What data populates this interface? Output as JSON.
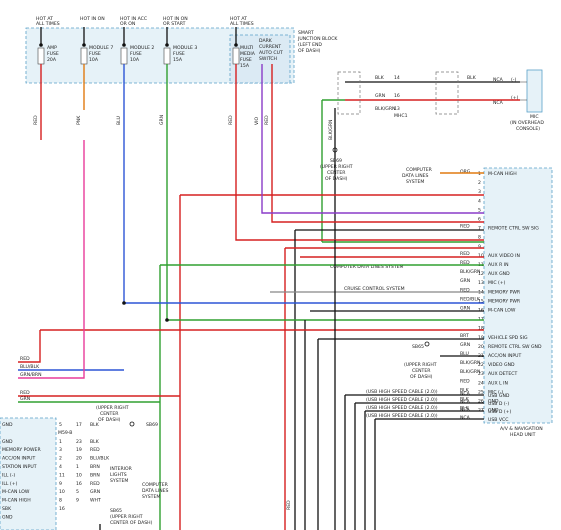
{
  "junction_block": {
    "title_lines": [
      "SMART",
      "JUNCTION BLOCK",
      "(LEFT END",
      "OF DASH)"
    ],
    "power_labels": [
      [
        "HOT AT",
        "ALL TIMES"
      ],
      [
        "HOT IN ON"
      ],
      [
        "HOT IN ACC",
        "OR ON"
      ],
      [
        "HOT IN ON",
        "OR START"
      ],
      [
        "HOT AT",
        "ALL TIMES"
      ]
    ],
    "fuses": [
      [
        "AMP",
        "FUSE",
        "20A"
      ],
      [
        "MODULE 7",
        "FUSE",
        "10A"
      ],
      [
        "MODULE 2",
        "FUSE",
        "10A"
      ],
      [
        "MODULE 3",
        "FUSE",
        "15A"
      ],
      [
        "MULTI",
        "MEDIA",
        "FUSE",
        "15A"
      ]
    ],
    "dark_current_lines": [
      "DARK",
      "CURRENT",
      "AUTO CUT",
      "SWITCH"
    ],
    "pin_labels": [
      "4E",
      "2I",
      "2B",
      "2F",
      "2T",
      "2A"
    ],
    "wire_labels": [
      "RED",
      "PNK",
      "BLU",
      "ORN",
      "GRN",
      "VIO"
    ],
    "pin_ids": [
      "27",
      "27",
      "21"
    ]
  },
  "mic": {
    "label_lines": [
      "MIC",
      "(IN OVERHEAD",
      "CONSOLE)"
    ],
    "terminals": [
      "NCA",
      "NCA",
      "(-)",
      "(+)"
    ],
    "wires": [
      {
        "color": "BLK",
        "pin": "14"
      },
      {
        "color": "BLK",
        "pin": "11"
      },
      {
        "color": "GRN",
        "pin": "16"
      },
      {
        "color": "BLK/GRN",
        "pin": "13"
      }
    ],
    "connector": "MHC1"
  },
  "sb69": {
    "label_lines": [
      "SB69",
      "(UPPER RIGHT",
      "CENTER",
      "OF DASH)"
    ],
    "wire": "BLK/GRN"
  },
  "head_unit": {
    "label_lines": [
      "A/V & NAVIGATION",
      "HEAD UNIT"
    ],
    "pins": [
      {
        "name": "M-CAN HIGH",
        "n": "1",
        "w": "ORG"
      },
      {
        "name": "",
        "n": "2",
        "w": ""
      },
      {
        "name": "",
        "n": "3",
        "w": ""
      },
      {
        "name": "",
        "n": "4",
        "w": ""
      },
      {
        "name": "",
        "n": "5",
        "w": ""
      },
      {
        "name": "",
        "n": "6",
        "w": ""
      },
      {
        "name": "REMOTE CTRL SW SIG",
        "n": "7",
        "w": "RED"
      },
      {
        "name": "",
        "n": "8",
        "w": ""
      },
      {
        "name": "",
        "n": "9",
        "w": ""
      },
      {
        "name": "AUX VIDEO IN",
        "n": "10",
        "w": "RED"
      },
      {
        "name": "AUX R IN",
        "n": "11",
        "w": "RED"
      },
      {
        "name": "AUX GND",
        "n": "12",
        "w": "BLK/GRN"
      },
      {
        "name": "MIC (+)",
        "n": "13",
        "w": "GRN"
      },
      {
        "name": "MEMORY PWR",
        "n": "14",
        "w": "RED"
      },
      {
        "name": "MEMORY PWR",
        "n": "15",
        "w": "RED/BLK"
      },
      {
        "name": "M-CAN LOW",
        "n": "16",
        "w": "GRN"
      },
      {
        "name": "",
        "n": "17",
        "w": ""
      },
      {
        "name": "",
        "n": "18",
        "w": ""
      },
      {
        "name": "VEHICLE SPD SIG",
        "n": "19",
        "w": "BRT"
      },
      {
        "name": "REMOTE CTRL SW GND",
        "n": "20",
        "w": "GRN"
      },
      {
        "name": "ACC/ON INPUT",
        "n": "21",
        "w": "BLU"
      },
      {
        "name": "VIDEO GND",
        "n": "22",
        "w": "BLK/GRN"
      },
      {
        "name": "AUX DETECT",
        "n": "23",
        "w": "BLK/GRN"
      },
      {
        "name": "AUX L IN",
        "n": "24",
        "w": "RED"
      },
      {
        "name": "MIC (-)",
        "n": "25",
        "w": "BLK"
      },
      {
        "name": "GND",
        "n": "26",
        "w": "BLK"
      },
      {
        "name": "GND",
        "n": "27",
        "w": "BLK"
      }
    ],
    "usb_pins": [
      {
        "name": "USB GND",
        "n": "",
        "w": "NCA"
      },
      {
        "name": "USB D (-)",
        "n": "",
        "w": "NCA"
      },
      {
        "name": "USB D (+)",
        "n": "",
        "w": "NCA"
      },
      {
        "name": "USB VCC",
        "n": "",
        "w": "NCA"
      }
    ],
    "connector_labels": [
      "M59-B",
      "M59-GND"
    ]
  },
  "computer_links": [
    [
      "COMPUTER",
      "DATA LINES",
      "SYSTEM"
    ],
    [
      "COMPUTER DATA LINES SYSTEM"
    ],
    [
      "CRUISE CONTROL SYSTEM"
    ]
  ],
  "sb65": {
    "label_lines": [
      "SB65",
      "(UPPER RIGHT",
      "CENTER",
      "OF DASH)"
    ]
  },
  "usb_cables": [
    "(USB HIGH SPEED CABLE (2.0))",
    "(USB HIGH SPEED CABLE (2.0))",
    "(USB HIGH SPEED CABLE (2.0))",
    "(USB HIGH SPEED CABLE (2.0))"
  ],
  "left_wires": [
    "RED",
    "BLU/BLK",
    "GRN/BRN",
    "RED",
    "GRN"
  ],
  "sw_box": {
    "label_lines": [
      "(UPPER RIGHT",
      "CENTER",
      "OF DASH)"
    ],
    "sb_label": "SB69",
    "connector": "M59-B",
    "rows": [
      {
        "name": "GND",
        "n": "5",
        "pin": "17",
        "w": "BLK"
      },
      {
        "name": "",
        "n": "",
        "pin": "",
        "w": ""
      },
      {
        "name": "GND",
        "n": "1",
        "pin": "23",
        "w": "BLK"
      },
      {
        "name": "MEMORY POWER",
        "n": "3",
        "pin": "19",
        "w": "RED"
      },
      {
        "name": "ACC/ON INPUT",
        "n": "2",
        "pin": "20",
        "w": "BLU/BLK"
      },
      {
        "name": "STATION INPUT",
        "n": "4",
        "pin": "1",
        "w": "BRN"
      },
      {
        "name": "ILL (-)",
        "n": "11",
        "pin": "10",
        "w": "BRN"
      },
      {
        "name": "ILL (+)",
        "n": "9",
        "pin": "16",
        "w": "RED"
      },
      {
        "name": "M-CAN LOW",
        "n": "10",
        "pin": "5",
        "w": "GRN"
      },
      {
        "name": "M-CAN HIGH",
        "n": "8",
        "pin": "9",
        "w": "WHT"
      },
      {
        "name": "SBK",
        "n": "16",
        "pin": "",
        "w": ""
      },
      {
        "name": "GND",
        "n": "",
        "pin": "",
        "w": ""
      }
    ],
    "interior_lights": [
      "INTERIOR",
      "LIGHTS",
      "SYSTEM"
    ],
    "comp_data": [
      "COMPUTER",
      "DATA LINES",
      "SYSTEM"
    ],
    "bottom_sb": [
      "SB65",
      "(UPPER RIGHT",
      "CENTER OF DASH)"
    ]
  },
  "misc": {
    "blk_grn_vert": "BLK/GRN",
    "grn_brn_vert": "GRN/BRN"
  }
}
